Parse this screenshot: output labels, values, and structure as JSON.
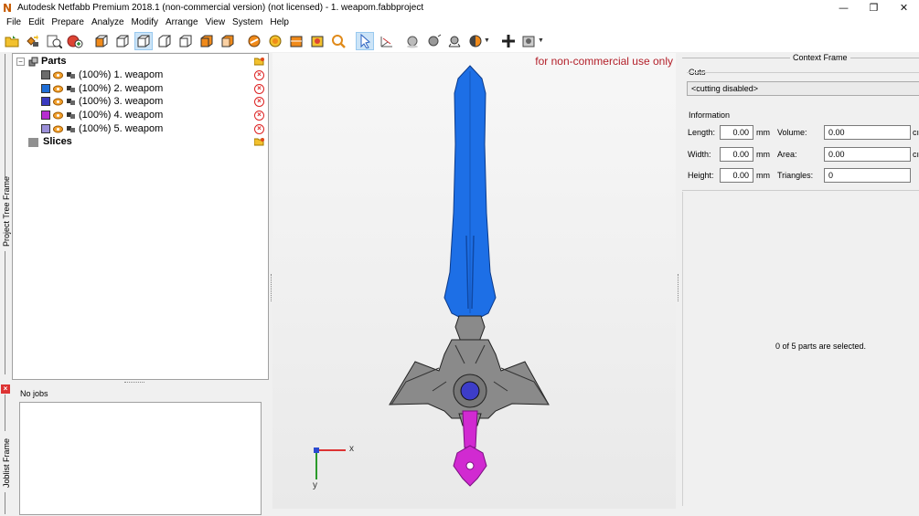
{
  "window": {
    "title": "Autodesk Netfabb Premium 2018.1 (non-commercial version) (not licensed) - 1. weapom.fabbproject",
    "app_icon_letter": "N",
    "controls": {
      "minimize": "—",
      "maximize": "❐",
      "close": "✕"
    }
  },
  "menu": [
    "File",
    "Edit",
    "Prepare",
    "Analyze",
    "Modify",
    "Arrange",
    "View",
    "System",
    "Help"
  ],
  "toolbar": {
    "icons": [
      "open-project-icon",
      "add-part-icon",
      "part-info-icon",
      "add-support-icon",
      "view-front-icon",
      "view-back-icon",
      "view-left-icon",
      "view-right-icon",
      "view-top-icon",
      "view-bottom-icon",
      "view-perspective-icon",
      "repair-icon",
      "shell-icon",
      "cut-icon",
      "measure-icon",
      "zoom-icon",
      "select-icon",
      "axis-icon",
      "sphere-icon",
      "shading-icon",
      "light-icon",
      "color-icon",
      "move-icon",
      "camera-icon"
    ]
  },
  "side_tabs": {
    "project_tree": "Project Tree Frame",
    "joblist": "Joblist Frame"
  },
  "tree": {
    "parts_label": "Parts",
    "slices_label": "Slices",
    "expander": "−",
    "items": [
      {
        "label": "(100%) 1. weapom",
        "color": "#6b6b6b"
      },
      {
        "label": "(100%) 2. weapom",
        "color": "#1f6ed6"
      },
      {
        "label": "(100%) 3. weapom",
        "color": "#3a3ac0"
      },
      {
        "label": "(100%) 4. weapom",
        "color": "#b72ed0"
      },
      {
        "label": "(100%) 5. weapom",
        "color": "#9b8fd8"
      }
    ],
    "remove_symbol": "×"
  },
  "joblist": {
    "close_symbol": "×",
    "status": "No jobs"
  },
  "viewport": {
    "watermark": "for non-commercial use only",
    "axis_x": "x",
    "axis_y": "y",
    "colors": {
      "blade": "#1d6fe6",
      "guard": "#8a8a8a",
      "grip": "#d12ad1",
      "gem": "#3d3dc8"
    }
  },
  "context": {
    "title": "Context Frame",
    "cuts": {
      "label": "Cuts",
      "value": "<cutting disabled>"
    },
    "information": {
      "label": "Information",
      "length": {
        "label": "Length:",
        "value": "0.00",
        "unit": "mm"
      },
      "width": {
        "label": "Width:",
        "value": "0.00",
        "unit": "mm"
      },
      "height": {
        "label": "Height:",
        "value": "0.00",
        "unit": "mm"
      },
      "volume": {
        "label": "Volume:",
        "value": "0.00",
        "unit": "cı"
      },
      "area": {
        "label": "Area:",
        "value": "0.00",
        "unit": "cı"
      },
      "triangles": {
        "label": "Triangles:",
        "value": "0"
      }
    },
    "selection_status": "0 of 5 parts are selected."
  }
}
